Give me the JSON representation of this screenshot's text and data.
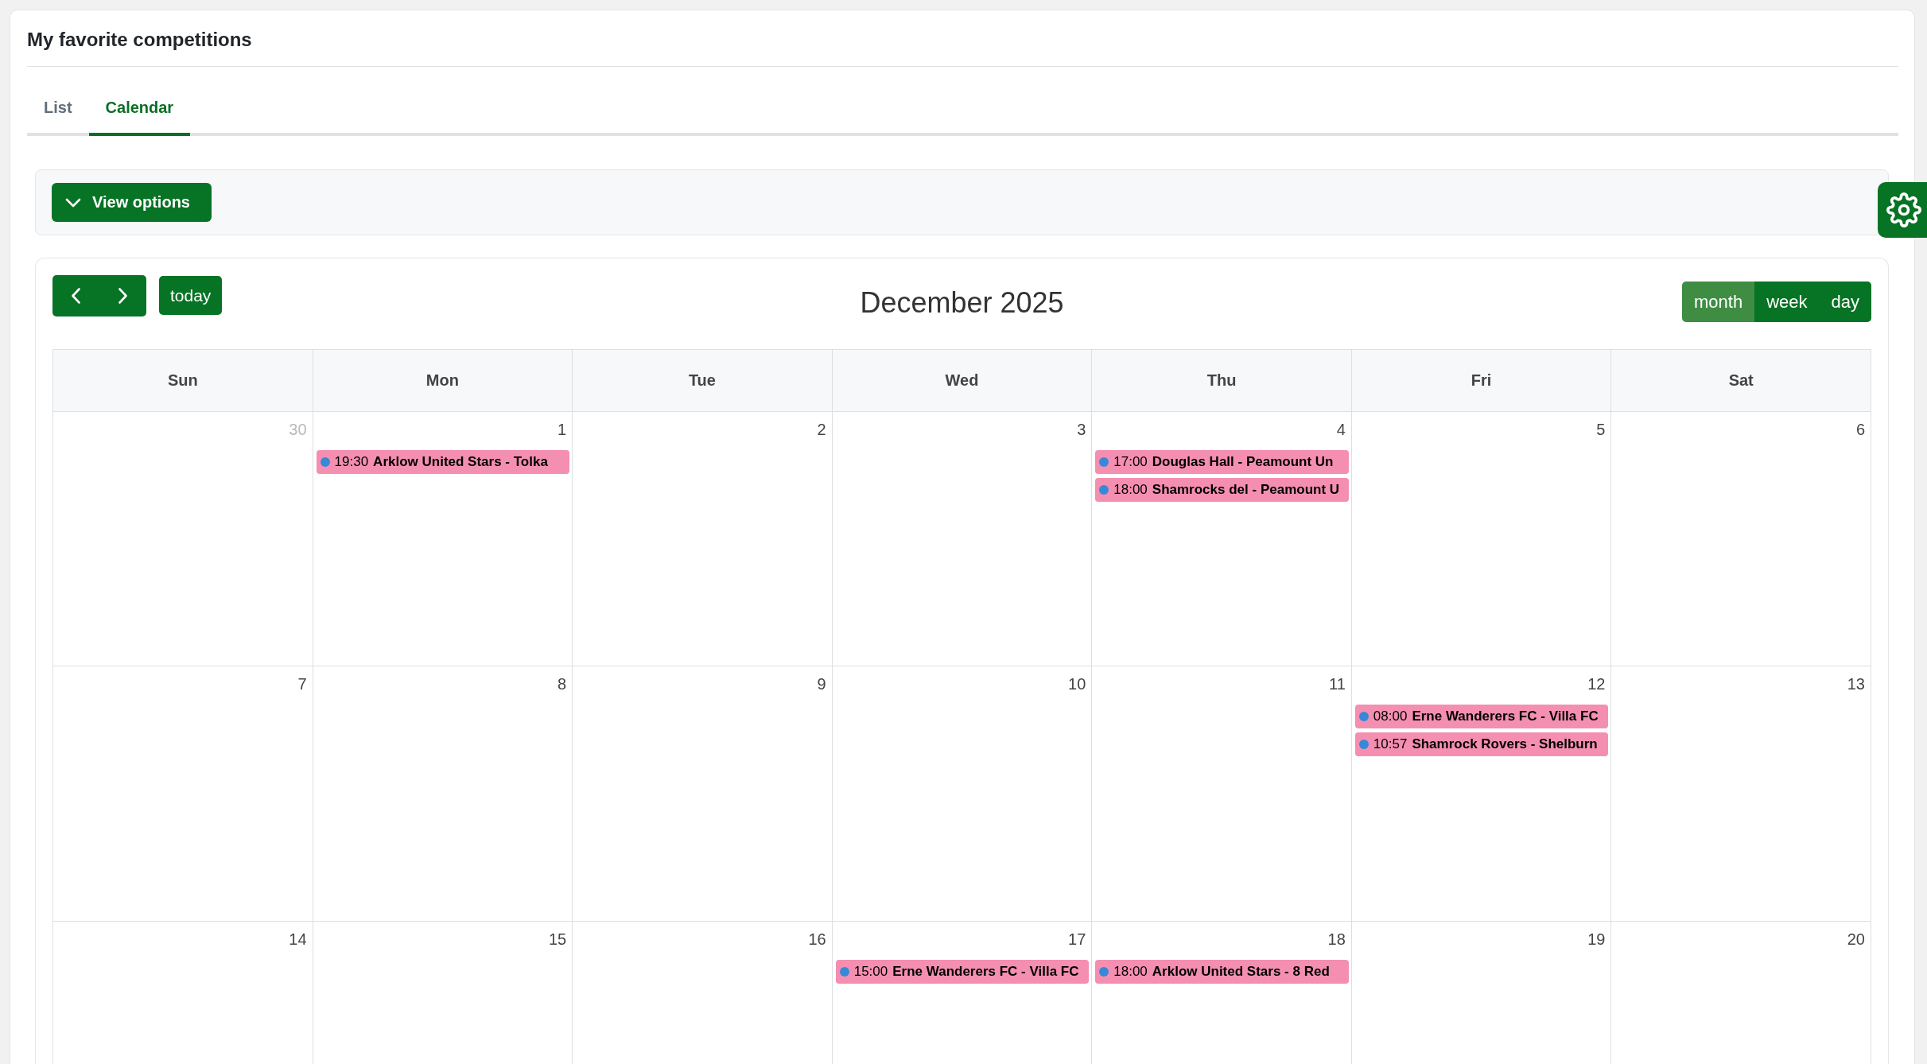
{
  "page_title": "My favorite competitions",
  "tabs": [
    {
      "label": "List",
      "selected": false
    },
    {
      "label": "Calendar",
      "selected": true
    }
  ],
  "view_options": {
    "label": "View options",
    "expanded": false
  },
  "calendar": {
    "title": "December 2025",
    "today_label": "today",
    "views": [
      {
        "label": "month",
        "selected": true
      },
      {
        "label": "week",
        "selected": false
      },
      {
        "label": "day",
        "selected": false
      }
    ],
    "weekdays": [
      "Sun",
      "Mon",
      "Tue",
      "Wed",
      "Thu",
      "Fri",
      "Sat"
    ],
    "weeks": [
      {
        "days": [
          {
            "date": "30",
            "other_month": true
          },
          {
            "date": "1",
            "other_month": false,
            "events": [
              {
                "time": "19:30",
                "title": "Arklow United Stars - Tolka"
              }
            ]
          },
          {
            "date": "2",
            "other_month": false
          },
          {
            "date": "3",
            "other_month": false
          },
          {
            "date": "4",
            "other_month": false,
            "events": [
              {
                "time": "17:00",
                "title": "Douglas Hall - Peamount Un"
              },
              {
                "time": "18:00",
                "title": "Shamrocks del - Peamount U"
              }
            ]
          },
          {
            "date": "5",
            "other_month": false
          },
          {
            "date": "6",
            "other_month": false
          }
        ]
      },
      {
        "days": [
          {
            "date": "7",
            "other_month": false
          },
          {
            "date": "8",
            "other_month": false
          },
          {
            "date": "9",
            "other_month": false
          },
          {
            "date": "10",
            "other_month": false
          },
          {
            "date": "11",
            "other_month": false
          },
          {
            "date": "12",
            "other_month": false,
            "events": [
              {
                "time": "08:00",
                "title": "Erne Wanderers FC - Villa FC"
              },
              {
                "time": "10:57",
                "title": "Shamrock Rovers - Shelburn"
              }
            ]
          },
          {
            "date": "13",
            "other_month": false
          }
        ]
      },
      {
        "days": [
          {
            "date": "14",
            "other_month": false
          },
          {
            "date": "15",
            "other_month": false
          },
          {
            "date": "16",
            "other_month": false
          },
          {
            "date": "17",
            "other_month": false,
            "events": [
              {
                "time": "15:00",
                "title": "Erne Wanderers FC - Villa FC"
              }
            ]
          },
          {
            "date": "18",
            "other_month": false,
            "events": [
              {
                "time": "18:00",
                "title": "Arklow United Stars - 8 Red"
              }
            ]
          },
          {
            "date": "19",
            "other_month": false
          },
          {
            "date": "20",
            "other_month": false
          }
        ]
      }
    ]
  }
}
